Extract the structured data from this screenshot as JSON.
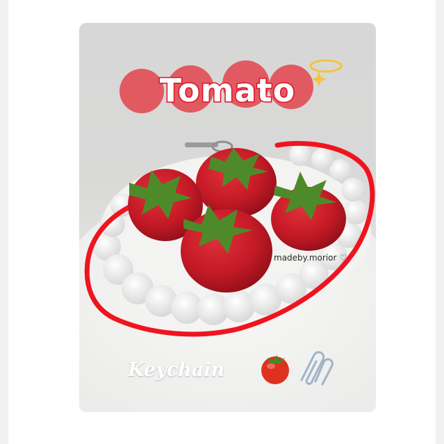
{
  "post": {
    "title": "Tomato",
    "caption": "Keychain",
    "credit": "madeby.morior ♡"
  },
  "colors": {
    "title_outline": "#e3102a",
    "marker_outline": "#f0141f",
    "tomato_red": "#c41a26",
    "leaf_green": "#4f8a2a"
  },
  "icons": [
    "sparkle-halo-icon",
    "tomato-emoji-icon",
    "paperclip-emoji-icon"
  ]
}
